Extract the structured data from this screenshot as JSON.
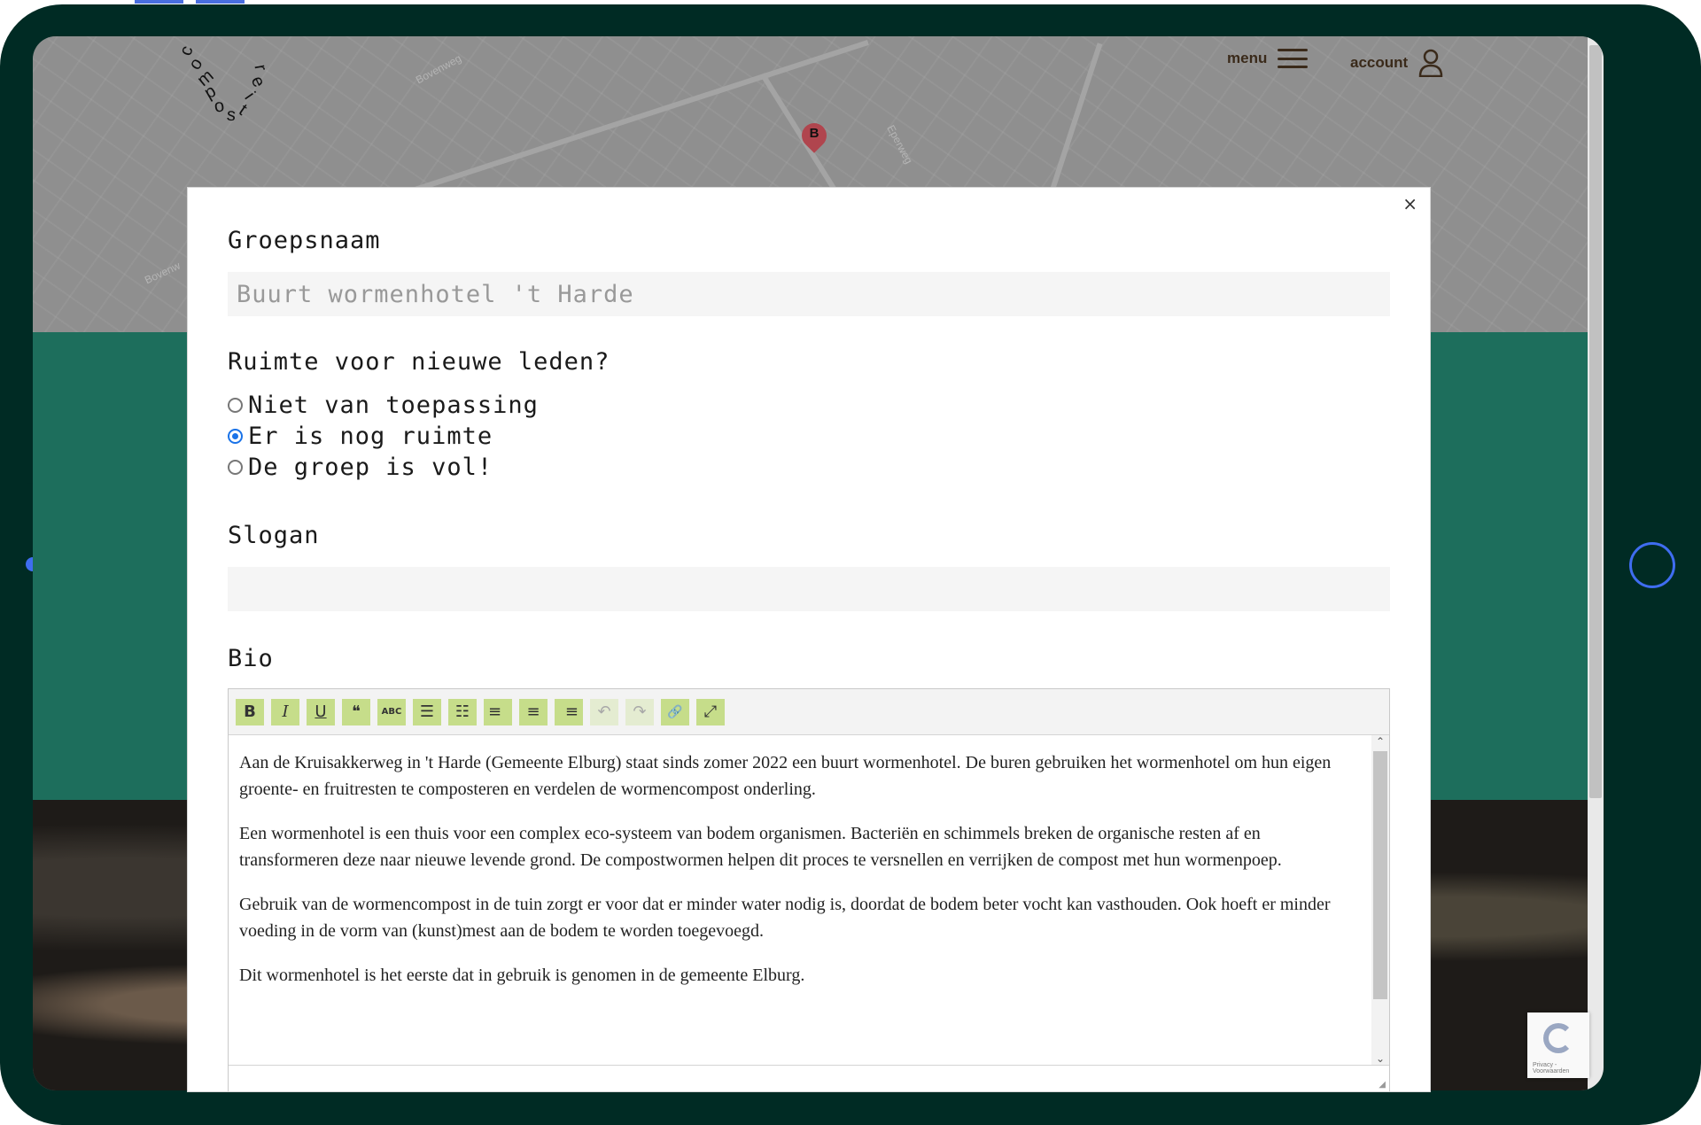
{
  "nav": {
    "logo_letters": [
      "c",
      "o",
      "m",
      "p",
      "o",
      "s",
      "t",
      "i",
      "e",
      "r"
    ],
    "menu_label": "menu",
    "account_label": "account"
  },
  "map": {
    "street_labels": [
      "Bovenweg",
      "Eperweg",
      "Bovenw"
    ],
    "pin_letter": "B"
  },
  "modal": {
    "close_symbol": "×",
    "group_name": {
      "label": "Groepsnaam",
      "placeholder": "Buurt wormenhotel 't Harde"
    },
    "space": {
      "label": "Ruimte voor nieuwe leden?",
      "options": [
        {
          "label": "Niet van toepassing",
          "checked": false
        },
        {
          "label": "Er is nog ruimte",
          "checked": true
        },
        {
          "label": "De groep is vol!",
          "checked": false
        }
      ]
    },
    "slogan": {
      "label": "Slogan",
      "value": ""
    },
    "bio": {
      "label": "Bio",
      "toolbar": [
        {
          "name": "bold-icon",
          "glyph": "B"
        },
        {
          "name": "italic-icon",
          "glyph": "I"
        },
        {
          "name": "underline-icon",
          "glyph": "U"
        },
        {
          "name": "quote-icon",
          "glyph": "❝"
        },
        {
          "name": "strikethrough-icon",
          "glyph": "ABC"
        },
        {
          "name": "bullet-list-icon",
          "glyph": "☰"
        },
        {
          "name": "numbered-list-icon",
          "glyph": "☷"
        },
        {
          "name": "align-left-icon",
          "glyph": "≡"
        },
        {
          "name": "align-center-icon",
          "glyph": "≡"
        },
        {
          "name": "align-right-icon",
          "glyph": "≡"
        },
        {
          "name": "undo-icon",
          "glyph": "↶",
          "disabled": true
        },
        {
          "name": "redo-icon",
          "glyph": "↷",
          "disabled": true
        },
        {
          "name": "link-icon",
          "glyph": "🔗"
        },
        {
          "name": "fullscreen-icon",
          "glyph": "⤢"
        }
      ],
      "paragraphs": [
        "Aan de Kruisakkerweg in 't Harde (Gemeente Elburg) staat sinds zomer 2022 een buurt wormenhotel. De buren gebruiken het wormenhotel om hun eigen groente- en fruitresten te composteren en verdelen de wormencompost onderling.",
        "Een wormenhotel is een thuis voor een complex eco-systeem van bodem organismen. Bacteriën en schimmels breken de organische resten af en transformeren deze naar nieuwe levende grond. De compostwormen helpen dit proces te versnellen en verrijken de compost met hun wormenpoep.",
        "Gebruik van de wormencompost in de tuin zorgt er voor dat er minder water nodig is, doordat de bodem beter vocht kan vasthouden. Ook hoeft er minder voeding in de vorm van (kunst)mest aan de bodem te worden toegevoegd.",
        "Dit wormenhotel is het eerste dat in gebruik is genomen in de gemeente Elburg."
      ]
    }
  },
  "recaptcha": {
    "text": "Privacy - Voorwaarden"
  },
  "colors": {
    "frame": "#002b24",
    "accent": "#3f6df0",
    "section_green": "#1d6e5c",
    "toolbar_button": "#c6dd8a"
  }
}
